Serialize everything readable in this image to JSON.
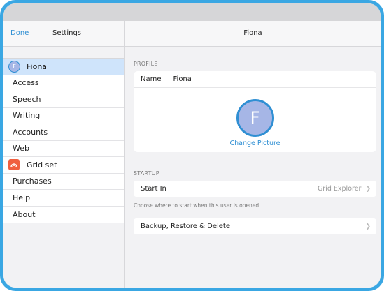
{
  "sidebar": {
    "done_label": "Done",
    "title": "Settings",
    "items": [
      {
        "label": "Fiona",
        "avatar_letter": "F"
      },
      {
        "label": "Access"
      },
      {
        "label": "Speech"
      },
      {
        "label": "Writing"
      },
      {
        "label": "Accounts"
      },
      {
        "label": "Web"
      },
      {
        "label": "Grid set"
      },
      {
        "label": "Purchases"
      },
      {
        "label": "Help"
      },
      {
        "label": "About"
      }
    ]
  },
  "main": {
    "title": "Fiona",
    "profile": {
      "section_header": "PROFILE",
      "name_label": "Name",
      "name_value": "Fiona",
      "avatar_letter": "F",
      "change_picture_label": "Change Picture"
    },
    "startup": {
      "section_header": "STARTUP",
      "start_in_label": "Start In",
      "start_in_value": "Grid Explorer",
      "note": "Choose where to start when this user is opened."
    },
    "backup_label": "Backup, Restore & Delete"
  },
  "colors": {
    "accent": "#2f8fd3",
    "selected_row": "#cfe4fb",
    "grid_set_icon": "#f06040",
    "device_border": "#3aa7e3"
  },
  "icons": {
    "chevron": "chevron-right-icon",
    "grid_set": "grid-set-icon"
  }
}
